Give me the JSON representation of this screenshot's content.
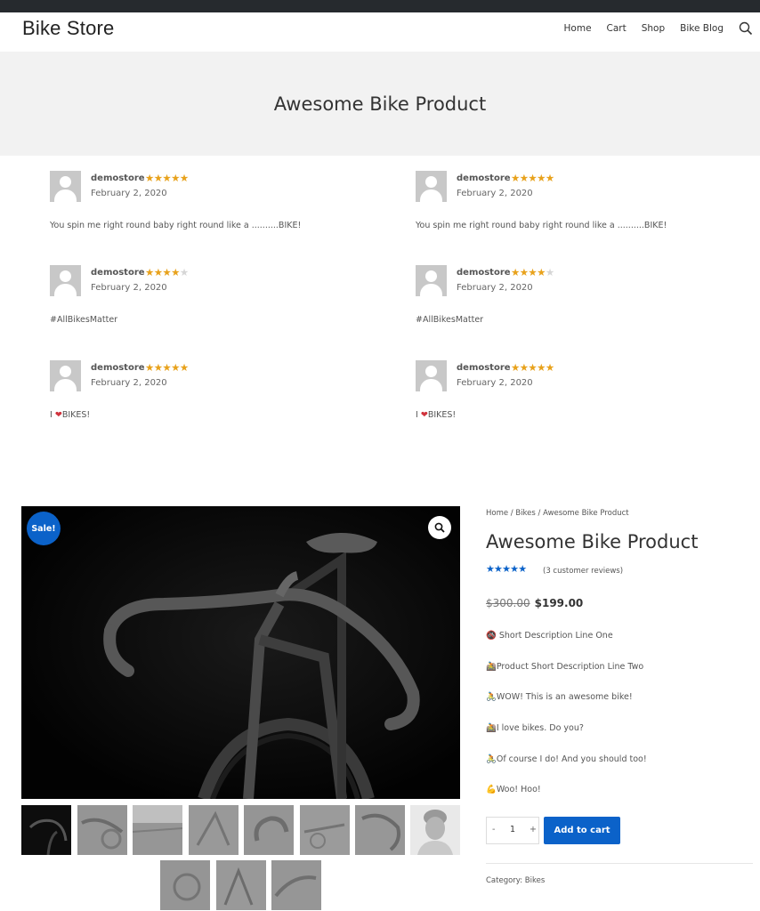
{
  "header": {
    "site_title": "Bike Store",
    "nav": [
      "Home",
      "Cart",
      "Shop",
      "Bike Blog"
    ],
    "search_icon": "search-icon"
  },
  "hero": {
    "title": "Awesome Bike Product"
  },
  "reviews": [
    {
      "author": "demostore",
      "rating": 5,
      "date": "February 2, 2020",
      "text": "You spin me right round baby right round like a ..........BIKE!"
    },
    {
      "author": "demostore",
      "rating": 5,
      "date": "February 2, 2020",
      "text": "You spin me right round baby right round like a ..........BIKE!"
    },
    {
      "author": "demostore",
      "rating": 4,
      "date": "February 2, 2020",
      "text": "#AllBikesMatter"
    },
    {
      "author": "demostore",
      "rating": 4,
      "date": "February 2, 2020",
      "text": "#AllBikesMatter"
    },
    {
      "author": "demostore",
      "rating": 5,
      "date": "February 2, 2020",
      "text": "BIKES!",
      "prefix": "I"
    },
    {
      "author": "demostore",
      "rating": 5,
      "date": "February 2, 2020",
      "text": "BIKES!",
      "prefix": "I"
    }
  ],
  "product": {
    "sale_badge": "Sale!",
    "breadcrumb": "Home / Bikes / Awesome Bike Product",
    "title": "Awesome Bike Product",
    "rating": 4.7,
    "review_count": "(3 customer reviews)",
    "old_price": "$300.00",
    "price": "$199.00",
    "descriptions": [
      {
        "emoji": "🚳",
        "text": " Short Description Line One"
      },
      {
        "emoji": "🚵",
        "text": "Product Short Description Line Two"
      },
      {
        "emoji": "🚴",
        "text": "WOW! This is an awesome bike!"
      },
      {
        "emoji": "🚵",
        "text": "I love bikes. Do you?"
      },
      {
        "emoji": "🚴",
        "text": "Of course I do! And you should too!"
      },
      {
        "emoji": "💪",
        "text": "Woo! Hoo!"
      }
    ],
    "quantity": "1",
    "qty_minus": "-",
    "qty_plus": "+",
    "add_to_cart": "Add to cart",
    "category": "Category: Bikes"
  },
  "colors": {
    "accent": "#0b62c9",
    "star": "#e8a21c",
    "topbar": "#262a2e",
    "hero_bg": "#f2f2f2"
  }
}
